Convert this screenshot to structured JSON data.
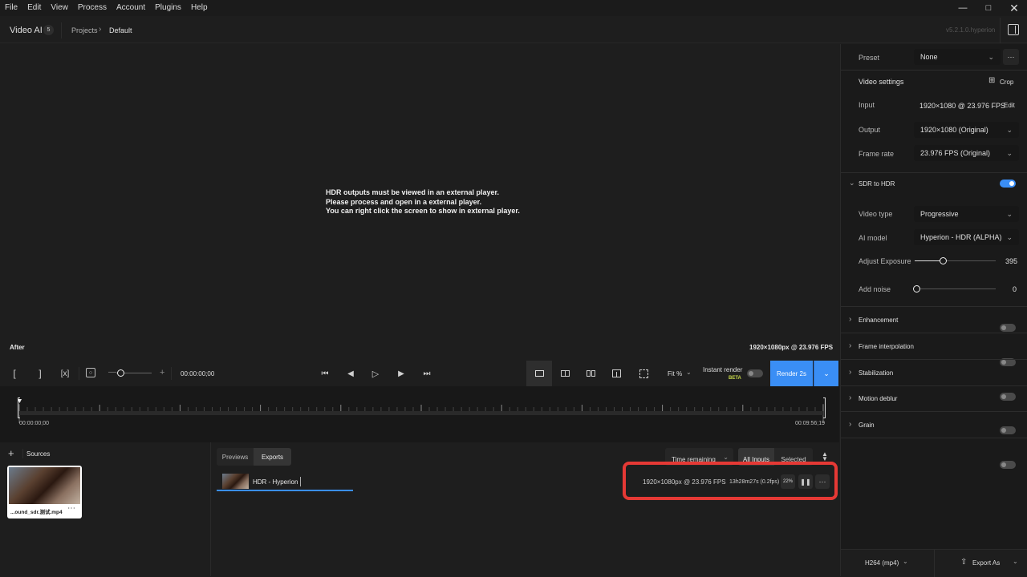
{
  "menu": {
    "items": [
      "File",
      "Edit",
      "View",
      "Process",
      "Account",
      "Plugins",
      "Help"
    ]
  },
  "header": {
    "app_name": "Video AI",
    "badge": "5",
    "breadcrumb_projects": "Projects",
    "breadcrumb_current": "Default",
    "version": "v5.2.1.0.hyperion"
  },
  "preview": {
    "message_line1": "HDR outputs must be viewed in an external player.",
    "message_line2": "Please process and open in a external player.",
    "message_line3": "You can right click the screen to show in external player.",
    "after_label": "After",
    "resolution": "1920×1080px @ 23.976 FPS"
  },
  "controls": {
    "timecode": "00:00:00;00",
    "fit_label": "Fit %",
    "instant_render": "Instant render",
    "beta": "BETA",
    "render_button": "Render 2s"
  },
  "timeline": {
    "start": "00:00:00;00",
    "end": "00:09:56;19"
  },
  "sources": {
    "title": "Sources",
    "file_name": "...ound_sdr.测试.mp4"
  },
  "exports": {
    "tab_previews": "Previews",
    "tab_exports": "Exports",
    "sort_label": "Time remaining",
    "filter_all": "All Inputs",
    "filter_selected": "Selected",
    "item_name": "HDR - Hyperion",
    "item_resolution": "1920×1080px @ 23.976 FPS",
    "item_time": "13h28m27s (0.2fps)",
    "item_percent": "22%"
  },
  "settings": {
    "preset_label": "Preset",
    "preset_value": "None",
    "video_settings": "Video settings",
    "crop": "Crop",
    "input_label": "Input",
    "input_value": "1920×1080 @ 23.976 FPS",
    "edit": "Edit",
    "output_label": "Output",
    "output_value": "1920×1080 (Original)",
    "framerate_label": "Frame rate",
    "framerate_value": "23.976 FPS (Original)",
    "sdr_to_hdr": "SDR to HDR",
    "video_type_label": "Video type",
    "video_type_value": "Progressive",
    "ai_model_label": "AI model",
    "ai_model_value": "Hyperion - HDR (ALPHA)",
    "exposure_label": "Adjust Exposure",
    "exposure_value": "395",
    "noise_label": "Add noise",
    "noise_value": "0",
    "enhancement": "Enhancement",
    "frame_interpolation": "Frame interpolation",
    "stabilization": "Stabilization",
    "motion_deblur": "Motion deblur",
    "grain": "Grain",
    "codec": "H264 (mp4)",
    "export_as": "Export As"
  },
  "colors": {
    "accent": "#3a8ef5",
    "highlight": "#e53935"
  }
}
